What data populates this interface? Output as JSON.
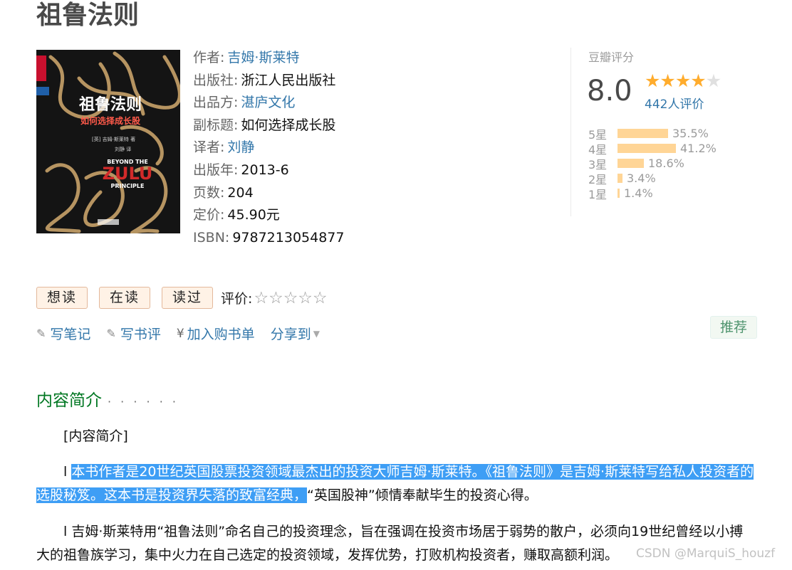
{
  "book": {
    "title": "祖鲁法则",
    "cover": {
      "title": "祖鲁法则",
      "subtitle": "如何选择成长股",
      "en_title_a": "ZULU",
      "en_top": "BEYOND THE",
      "en_bottom": "PRINCIPLE",
      "author_line": "[英] 吉姆·斯莱特 著",
      "translator_line": "刘静 译"
    },
    "info": [
      {
        "label": "作者:",
        "value": "吉姆·斯莱特",
        "link": true
      },
      {
        "label": "出版社:",
        "value": "浙江人民出版社",
        "link": false
      },
      {
        "label": "出品方:",
        "value": "湛庐文化",
        "link": true
      },
      {
        "label": "副标题:",
        "value": "如何选择成长股",
        "link": false
      },
      {
        "label": "译者:",
        "value": "刘静",
        "link": true
      },
      {
        "label": "出版年:",
        "value": "2013-6",
        "link": false
      },
      {
        "label": "页数:",
        "value": "204",
        "link": false
      },
      {
        "label": "定价:",
        "value": "45.90元",
        "link": false
      },
      {
        "label": "ISBN:",
        "value": "9787213054877",
        "link": false
      }
    ]
  },
  "rating": {
    "header": "豆瓣评分",
    "score": "8.0",
    "stars_filled": 4,
    "stars_total": 5,
    "count": "442人评价",
    "distribution": [
      {
        "label": "5星",
        "percent": "35.5%",
        "fraction": 0.355
      },
      {
        "label": "4星",
        "percent": "41.2%",
        "fraction": 0.412
      },
      {
        "label": "3星",
        "percent": "18.6%",
        "fraction": 0.186
      },
      {
        "label": "2星",
        "percent": "3.4%",
        "fraction": 0.034
      },
      {
        "label": "1星",
        "percent": "1.4%",
        "fraction": 0.014
      }
    ]
  },
  "actions": {
    "want": "想读",
    "reading": "在读",
    "read": "读过",
    "rate_label": "评价:",
    "rate_stars": "☆☆☆☆☆"
  },
  "links": {
    "note_icon": "pencil-icon",
    "note": "写笔记",
    "review_icon": "pencil-icon",
    "review": "写书评",
    "cart_icon": "¥",
    "cart": "加入购书单",
    "share": "分享到",
    "recommend": "推荐"
  },
  "intro": {
    "title": "内容简介",
    "dots": "· · · · · ·",
    "heading": "[内容简介]",
    "p2_prefix": "l ",
    "p2_highlight": "本书作者是20世纪英国股票投资领域最杰出的投资大师吉姆·斯莱特。《祖鲁法则》是吉姆·斯莱特写给私人投资者的选股秘笈。这本书是投资界失落的致富经典，",
    "p2_rest": "“英国股神”倾情奉献毕生的投资心得。",
    "p3": "l 吉姆·斯莱特用“祖鲁法则”命名自己的投资理念，旨在强调在投资市场居于弱势的散户，必须向19世纪曾经以小搏大的祖鲁族学习，集中火力在自己选定的投资领域，发挥优势，打败机构投资者，赚取高额利润。"
  },
  "watermark": "CSDN @MarquiS_houzf",
  "colors": {
    "link": "#3377aa",
    "star": "#ffac2d",
    "bar": "#ffd596",
    "section": "#007722",
    "highlight": "#3e9ef5"
  }
}
